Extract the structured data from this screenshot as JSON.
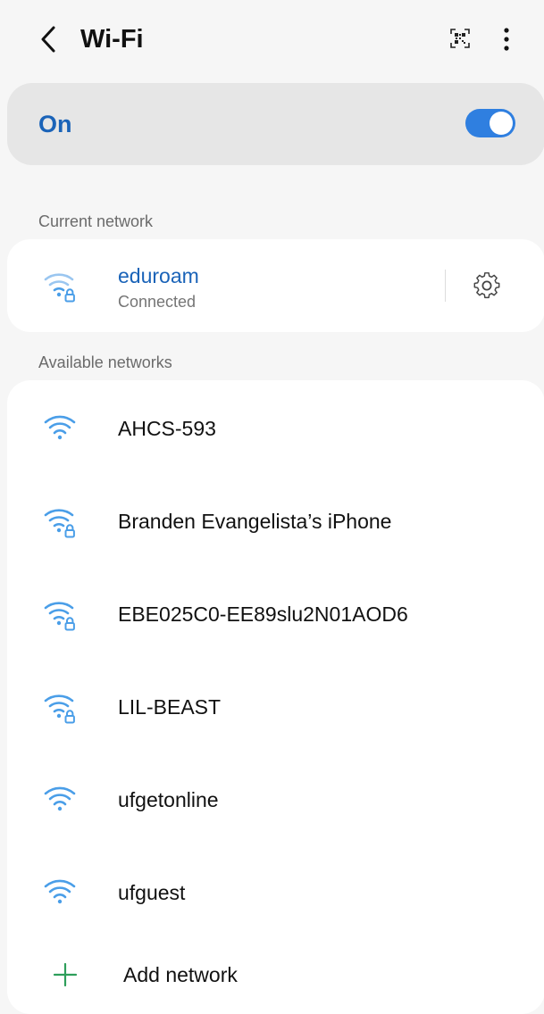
{
  "header": {
    "title": "Wi-Fi",
    "back_icon": "back-arrow-icon",
    "qr_icon": "qr-code-icon",
    "more_icon": "more-vertical-icon"
  },
  "wifi_toggle": {
    "label": "On",
    "state": "on",
    "accent_color": "#2f7fe0"
  },
  "current_network": {
    "section_label": "Current network",
    "name": "eduroam",
    "status": "Connected",
    "icon": "wifi-lock-icon",
    "settings_icon": "gear-icon"
  },
  "available_networks": {
    "section_label": "Available networks",
    "items": [
      {
        "name": "AHCS-593",
        "secured": false,
        "icon": "wifi-icon"
      },
      {
        "name": "Branden Evangelista’s iPhone",
        "secured": true,
        "icon": "wifi-lock-icon"
      },
      {
        "name": "EBE025C0-EE89slu2N01AOD6",
        "secured": true,
        "icon": "wifi-lock-icon"
      },
      {
        "name": "LIL-BEAST",
        "secured": true,
        "icon": "wifi-lock-icon"
      },
      {
        "name": "ufgetonline",
        "secured": false,
        "icon": "wifi-icon"
      },
      {
        "name": "ufguest",
        "secured": false,
        "icon": "wifi-icon"
      }
    ]
  },
  "add_network": {
    "label": "Add network",
    "icon": "plus-icon",
    "icon_color": "#2e9e5b"
  },
  "colors": {
    "accent_blue": "#1a63b8",
    "wifi_icon_blue": "#4a9ee8",
    "background": "#f6f6f6",
    "toggle_card": "#e6e6e6"
  }
}
